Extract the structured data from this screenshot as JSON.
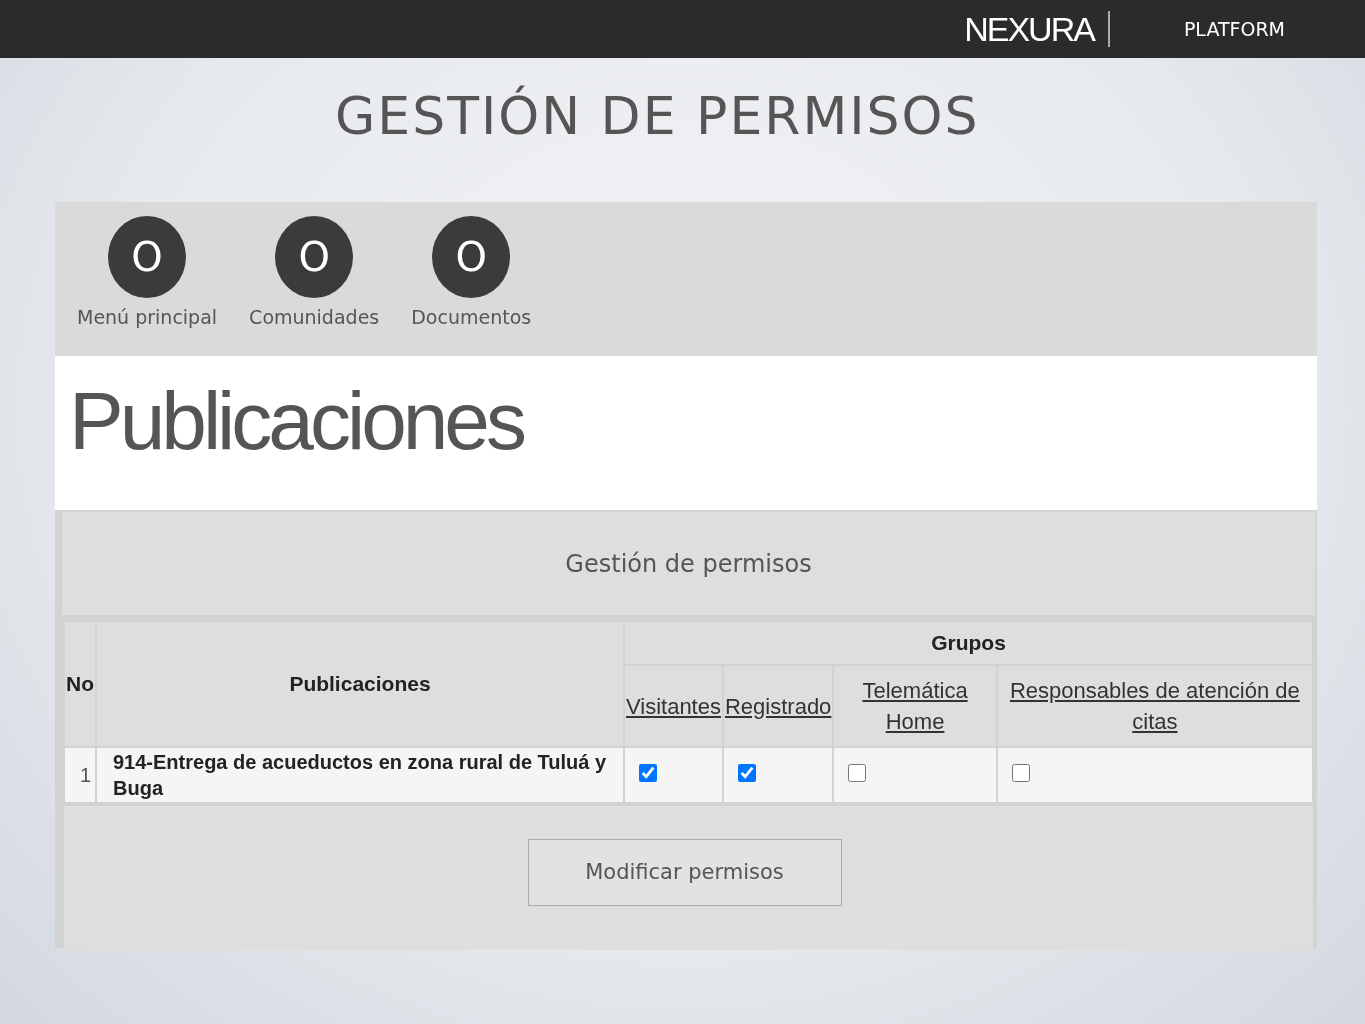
{
  "header": {
    "logo": "NEXURA",
    "label": "PLATFORM"
  },
  "title": "GESTIÓN DE PERMISOS",
  "nav": [
    {
      "icon_text": "O",
      "label": "Menú principal"
    },
    {
      "icon_text": "O",
      "label": "Comunidades"
    },
    {
      "icon_text": "O",
      "label": "Documentos"
    }
  ],
  "page_heading": "Publicaciones",
  "panel": {
    "title": "Gestión de permisos",
    "columns": {
      "number": "No",
      "item": "Publicaciones",
      "groups_heading": "Grupos",
      "groups": [
        "Visitantes",
        "Registrado",
        "Telemática Home",
        "Responsables de atención de citas"
      ]
    },
    "rows": [
      {
        "number": "1",
        "item": "914-Entrega de acueductos en zona rural de Tuluá y Buga",
        "permissions": [
          {
            "checked": true
          },
          {
            "checked": true
          },
          {
            "checked": false
          },
          {
            "checked": false
          }
        ]
      }
    ],
    "button": "Modificar permisos"
  }
}
